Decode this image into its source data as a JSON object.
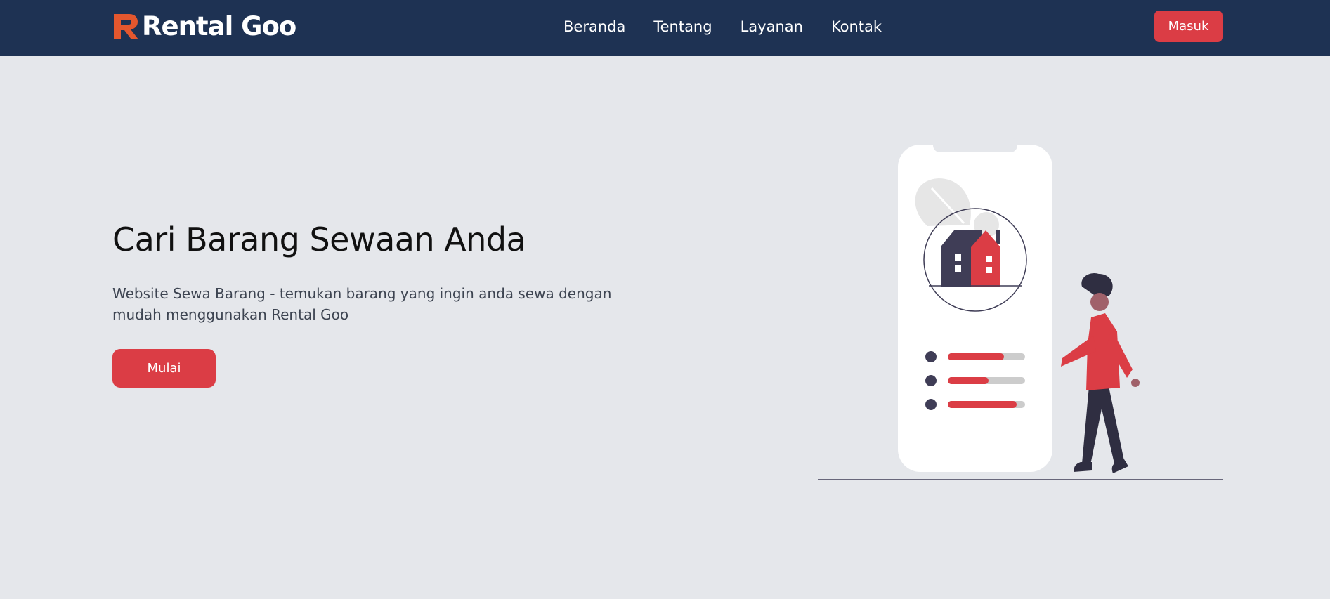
{
  "brand": {
    "name": "Rental Goo",
    "logo_icon": "rental-goo-logo-icon"
  },
  "nav": {
    "links": [
      "Beranda",
      "Tentang",
      "Layanan",
      "Kontak"
    ],
    "login_label": "Masuk"
  },
  "hero": {
    "title": "Cari Barang Sewaan Anda",
    "description": "Website Sewa Barang - temukan barang yang ingin anda sewa dengan mudah menggunakan Rental Goo",
    "cta_label": "Mulai",
    "illustration": "person-with-phone-house-listing"
  },
  "colors": {
    "navbar": "#1e3253",
    "accent": "#db3d45",
    "background": "#e5e7eb",
    "logo_orange": "#e4572e",
    "dark": "#3f3d56"
  }
}
